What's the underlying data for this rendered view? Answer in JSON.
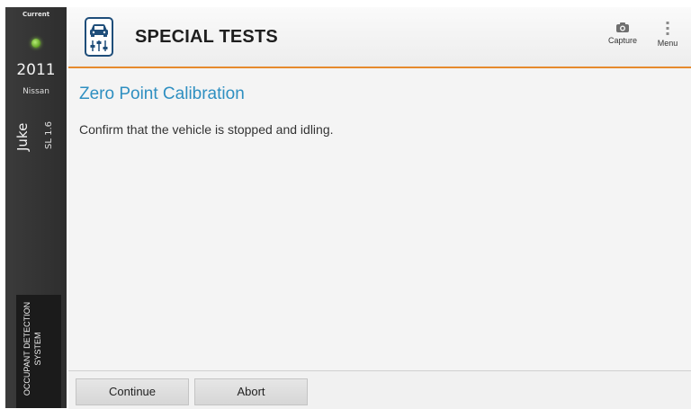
{
  "sidebar": {
    "current_label": "Current",
    "year": "2011",
    "make": "Nissan",
    "model": "Juke",
    "trim": "SL 1.6",
    "system": "OCCUPANT DETECTION SYSTEM",
    "status_color": "#6fbf2a"
  },
  "header": {
    "title": "SPECIAL TESTS",
    "capture_label": "Capture",
    "menu_label": "Menu",
    "accent_color": "#e68a2e",
    "icon": "car-sliders-icon"
  },
  "main": {
    "section_title": "Zero Point Calibration",
    "instruction": "Confirm that the vehicle is stopped and idling."
  },
  "footer": {
    "continue_label": "Continue",
    "abort_label": "Abort"
  }
}
